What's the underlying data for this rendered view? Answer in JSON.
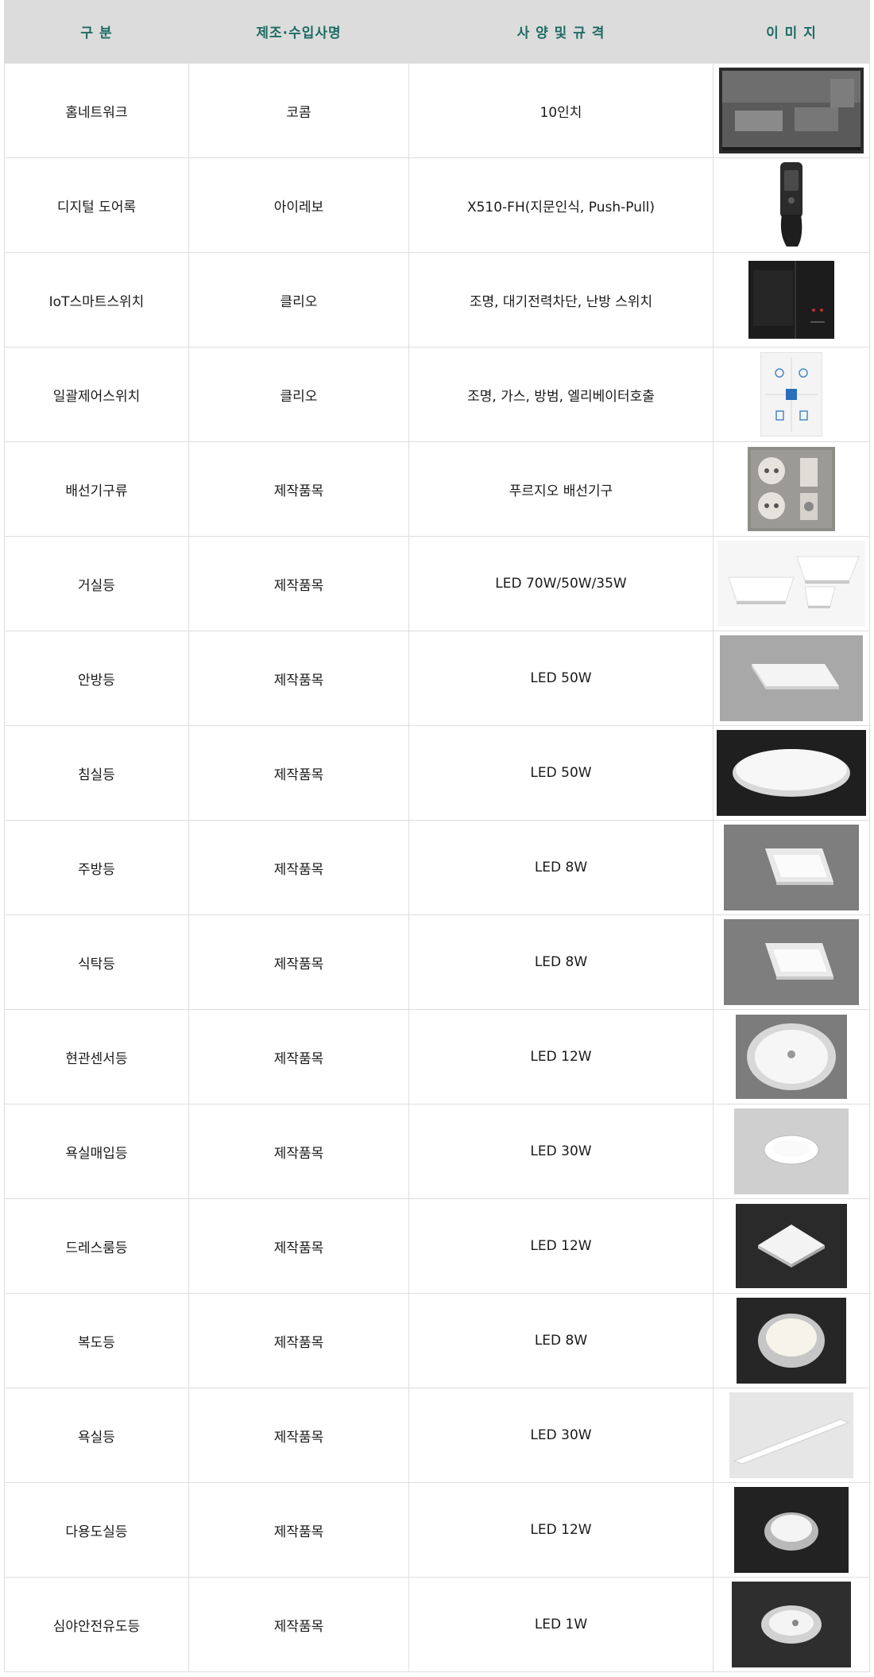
{
  "headers": [
    "구  분",
    "제조·수입사명",
    "사 양  및  규 격",
    "이 미 지"
  ],
  "rows": [
    {
      "category": "홈네트워크",
      "maker": "코콤",
      "spec": "10인치",
      "icon": "wallpad-icon"
    },
    {
      "category": "디지털 도어록",
      "maker": "아이레보",
      "spec": "X510-FH(지문인식, Push-Pull)",
      "icon": "door-lock-icon"
    },
    {
      "category": "IoT스마트스위치",
      "maker": "클리오",
      "spec": "조명, 대기전력차단, 난방 스위치",
      "icon": "smart-switch-icon"
    },
    {
      "category": "일괄제어스위치",
      "maker": "클리오",
      "spec": "조명, 가스, 방범, 엘리베이터호출",
      "icon": "master-switch-icon"
    },
    {
      "category": "배선기구류",
      "maker": "제작품목",
      "spec": "푸르지오 배선기구",
      "icon": "outlet-icon"
    },
    {
      "category": "거실등",
      "maker": "제작품목",
      "spec": "LED 70W/50W/35W",
      "icon": "living-room-light-icon"
    },
    {
      "category": "안방등",
      "maker": "제작품목",
      "spec": "LED 50W",
      "icon": "master-bedroom-light-icon"
    },
    {
      "category": "침실등",
      "maker": "제작품목",
      "spec": "LED 50W",
      "icon": "bedroom-light-icon"
    },
    {
      "category": "주방등",
      "maker": "제작품목",
      "spec": "LED 8W",
      "icon": "kitchen-light-icon"
    },
    {
      "category": "식탁등",
      "maker": "제작품목",
      "spec": "LED 8W",
      "icon": "dining-light-icon"
    },
    {
      "category": "현관센서등",
      "maker": "제작품목",
      "spec": "LED 12W",
      "icon": "entrance-sensor-light-icon"
    },
    {
      "category": "욕실매입등",
      "maker": "제작품목",
      "spec": "LED 30W",
      "icon": "bathroom-recessed-light-icon"
    },
    {
      "category": "드레스룸등",
      "maker": "제작품목",
      "spec": "LED 12W",
      "icon": "dressroom-light-icon"
    },
    {
      "category": "복도등",
      "maker": "제작품목",
      "spec": "LED 8W",
      "icon": "hallway-light-icon"
    },
    {
      "category": "욕실등",
      "maker": "제작품목",
      "spec": "LED 30W",
      "icon": "bathroom-light-icon"
    },
    {
      "category": "다용도실등",
      "maker": "제작품목",
      "spec": "LED 12W",
      "icon": "utility-room-light-icon"
    },
    {
      "category": "심야안전유도등",
      "maker": "제작품목",
      "spec": "LED 1W",
      "icon": "night-guide-light-icon"
    }
  ]
}
